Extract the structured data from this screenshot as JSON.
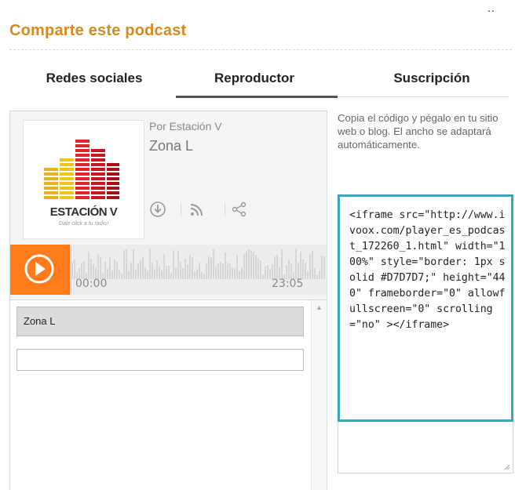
{
  "header": {
    "title": "Comparte este podcast",
    "ellipsis": ".."
  },
  "tabs": [
    {
      "label": "Redes sociales",
      "active": false
    },
    {
      "label": "Reproductor",
      "active": true
    },
    {
      "label": "Suscripción",
      "active": false
    }
  ],
  "player": {
    "logo": {
      "text": "ESTACIÓN V",
      "tagline": "Dale click a tu radio!"
    },
    "author": "Por Estación V",
    "title": "Zona L",
    "icons": [
      "download-icon",
      "rss-icon",
      "share-icon"
    ],
    "time_start": "00:00",
    "time_end": "23:05",
    "playlist": [
      {
        "label": "Zona L"
      }
    ]
  },
  "embed": {
    "instructions": "Copia el código y pégalo en tu sitio web o blog. El ancho se adaptará automáticamente.",
    "code": "<iframe src=\"http://www.ivoox.com/player_es_podcast_172260_1.html\" width=\"100%\" style=\"border: 1px solid #D7D7D7;\" height=\"440\" frameborder=\"0\" allowfullscreen=\"0\" scrolling=\"no\" ></iframe>"
  },
  "colors": {
    "accent": "#d88a1c",
    "play": "#ff7b1c",
    "code_border": "#3aa6c6"
  }
}
